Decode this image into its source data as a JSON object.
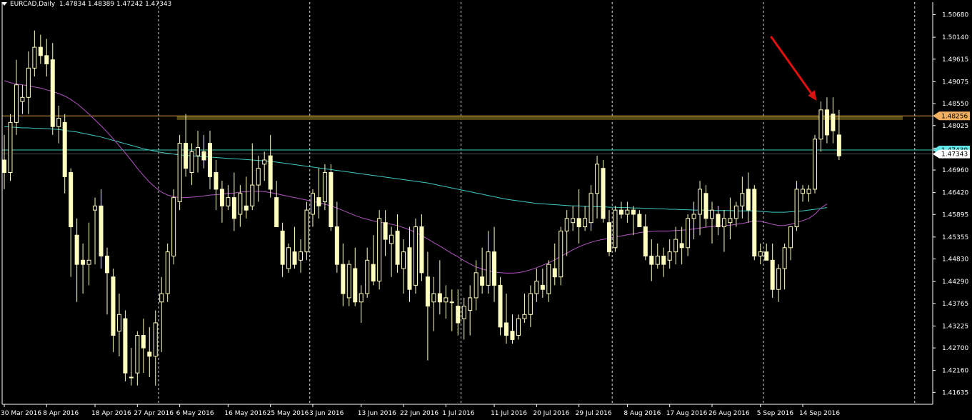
{
  "header": {
    "symbol": "EURCAD,Daily",
    "ohlc": "1.47834 1.48389 1.47242 1.47343"
  },
  "colors": {
    "background": "#000000",
    "candle": "#ffffc0",
    "axis": "#ffffff",
    "grid_vertical": "#ffffff",
    "resistance_zone": "#544a16",
    "resistance_line": "#d8a040",
    "ma_fast": "#b054c0",
    "ma_slow": "#40c8c0",
    "arrow": "#e01010",
    "price_tag_resistance": "#f0b060",
    "price_tag_slow": "#60e8e8",
    "price_tag_current": "#ffffff"
  },
  "chart_data": {
    "type": "candlestick",
    "title": "EURCAD,Daily",
    "ylim": [
      1.4135,
      1.5098
    ],
    "y_ticks": [
      "1.50680",
      "1.50140",
      "1.49615",
      "1.49075",
      "1.48550",
      "1.48025",
      "1.47485",
      "1.46960",
      "1.46420",
      "1.45895",
      "1.45355",
      "1.44830",
      "1.44290",
      "1.43765",
      "1.43225",
      "1.42700",
      "1.42160",
      "1.41635"
    ],
    "x_labels": [
      "30 Mar 2016",
      "8 Apr 2016",
      "18 Apr 2016",
      "27 Apr 2016",
      "6 May 2016",
      "16 May 2016",
      "25 May 2016",
      "3 Jun 2016",
      "13 Jun 2016",
      "22 Jun 2016",
      "1 Jul 2016",
      "11 Jul 2016",
      "20 Jul 2016",
      "29 Jul 2016",
      "8 Aug 2016",
      "17 Aug 2016",
      "26 Aug 2016",
      "5 Sep 2016",
      "14 Sep 2016"
    ],
    "x_label_bar_index": [
      0,
      7,
      15,
      22,
      29,
      37,
      44,
      51,
      59,
      66,
      73,
      81,
      88,
      95,
      103,
      110,
      117,
      125,
      132
    ],
    "grid_vertical_bar_index": [
      25,
      50,
      75,
      100,
      125,
      150
    ],
    "price_tags": {
      "resistance": "1.48256",
      "slow_ma": "1.47439",
      "current": "1.47343"
    },
    "resistance_level": 1.48256,
    "resistance_zone": [
      1.4816,
      1.48256
    ],
    "ohlc_note": "open, high, low, close",
    "candles": [
      [
        1.472,
        1.478,
        1.465,
        1.469
      ],
      [
        1.469,
        1.483,
        1.467,
        1.481
      ],
      [
        1.481,
        1.496,
        1.478,
        1.49
      ],
      [
        1.486,
        1.49,
        1.483,
        1.487
      ],
      [
        1.487,
        1.498,
        1.483,
        1.494
      ],
      [
        1.494,
        1.503,
        1.492,
        1.499
      ],
      [
        1.499,
        1.502,
        1.495,
        1.497
      ],
      [
        1.497,
        1.501,
        1.492,
        1.495
      ],
      [
        1.496,
        1.5,
        1.478,
        1.48
      ],
      [
        1.48,
        1.485,
        1.476,
        1.482
      ],
      [
        1.481,
        1.483,
        1.464,
        1.468
      ],
      [
        1.469,
        1.47,
        1.444,
        1.456
      ],
      [
        1.454,
        1.458,
        1.438,
        1.447
      ],
      [
        1.448,
        1.452,
        1.44,
        1.447
      ],
      [
        1.447,
        1.457,
        1.442,
        1.448
      ],
      [
        1.46,
        1.463,
        1.447,
        1.461
      ],
      [
        1.461,
        1.465,
        1.446,
        1.449
      ],
      [
        1.449,
        1.451,
        1.435,
        1.445
      ],
      [
        1.444,
        1.446,
        1.426,
        1.43
      ],
      [
        1.431,
        1.44,
        1.425,
        1.435
      ],
      [
        1.434,
        1.436,
        1.419,
        1.421
      ],
      [
        1.42,
        1.427,
        1.418,
        1.42
      ],
      [
        1.421,
        1.431,
        1.418,
        1.43
      ],
      [
        1.43,
        1.434,
        1.421,
        1.427
      ],
      [
        1.426,
        1.432,
        1.42,
        1.425
      ],
      [
        1.425,
        1.436,
        1.418,
        1.433
      ],
      [
        1.438,
        1.444,
        1.426,
        1.44
      ],
      [
        1.44,
        1.452,
        1.438,
        1.45
      ],
      [
        1.449,
        1.465,
        1.447,
        1.463
      ],
      [
        1.462,
        1.478,
        1.46,
        1.476
      ],
      [
        1.476,
        1.483,
        1.468,
        1.47
      ],
      [
        1.469,
        1.476,
        1.466,
        1.474
      ],
      [
        1.473,
        1.479,
        1.469,
        1.475
      ],
      [
        1.474,
        1.478,
        1.47,
        1.472
      ],
      [
        1.476,
        1.479,
        1.465,
        1.468
      ],
      [
        1.469,
        1.472,
        1.46,
        1.465
      ],
      [
        1.465,
        1.467,
        1.457,
        1.461
      ],
      [
        1.461,
        1.466,
        1.46,
        1.463
      ],
      [
        1.463,
        1.469,
        1.455,
        1.458
      ],
      [
        1.459,
        1.466,
        1.456,
        1.464
      ],
      [
        1.461,
        1.468,
        1.458,
        1.46
      ],
      [
        1.461,
        1.476,
        1.46,
        1.466
      ],
      [
        1.466,
        1.473,
        1.462,
        1.47
      ],
      [
        1.471,
        1.474,
        1.467,
        1.472
      ],
      [
        1.473,
        1.478,
        1.463,
        1.465
      ],
      [
        1.463,
        1.467,
        1.456,
        1.456
      ],
      [
        1.455,
        1.457,
        1.444,
        1.447
      ],
      [
        1.446,
        1.452,
        1.445,
        1.451
      ],
      [
        1.45,
        1.456,
        1.446,
        1.447
      ],
      [
        1.448,
        1.453,
        1.445,
        1.45
      ],
      [
        1.45,
        1.462,
        1.448,
        1.46
      ],
      [
        1.459,
        1.465,
        1.456,
        1.464
      ],
      [
        1.463,
        1.47,
        1.458,
        1.461
      ],
      [
        1.462,
        1.471,
        1.46,
        1.469
      ],
      [
        1.469,
        1.471,
        1.455,
        1.456
      ],
      [
        1.456,
        1.462,
        1.445,
        1.447
      ],
      [
        1.447,
        1.452,
        1.437,
        1.44
      ],
      [
        1.439,
        1.448,
        1.437,
        1.447
      ],
      [
        1.446,
        1.451,
        1.437,
        1.438
      ],
      [
        1.438,
        1.442,
        1.433,
        1.44
      ],
      [
        1.44,
        1.451,
        1.439,
        1.448
      ],
      [
        1.447,
        1.454,
        1.442,
        1.443
      ],
      [
        1.443,
        1.46,
        1.441,
        1.458
      ],
      [
        1.457,
        1.46,
        1.449,
        1.453
      ],
      [
        1.452,
        1.456,
        1.444,
        1.454
      ],
      [
        1.455,
        1.459,
        1.445,
        1.447
      ],
      [
        1.446,
        1.453,
        1.44,
        1.45
      ],
      [
        1.451,
        1.456,
        1.438,
        1.441
      ],
      [
        1.442,
        1.458,
        1.44,
        1.456
      ],
      [
        1.456,
        1.459,
        1.443,
        1.445
      ],
      [
        1.444,
        1.45,
        1.424,
        1.437
      ],
      [
        1.438,
        1.444,
        1.431,
        1.44
      ],
      [
        1.44,
        1.448,
        1.435,
        1.438
      ],
      [
        1.438,
        1.442,
        1.434,
        1.439
      ],
      [
        1.438,
        1.441,
        1.431,
        1.438
      ],
      [
        1.437,
        1.441,
        1.43,
        1.433
      ],
      [
        1.434,
        1.439,
        1.429,
        1.437
      ],
      [
        1.436,
        1.442,
        1.43,
        1.439
      ],
      [
        1.439,
        1.448,
        1.436,
        1.445
      ],
      [
        1.444,
        1.451,
        1.44,
        1.442
      ],
      [
        1.442,
        1.455,
        1.44,
        1.45
      ],
      [
        1.45,
        1.456,
        1.438,
        1.442
      ],
      [
        1.442,
        1.444,
        1.43,
        1.432
      ],
      [
        1.433,
        1.44,
        1.428,
        1.43
      ],
      [
        1.431,
        1.435,
        1.428,
        1.429
      ],
      [
        1.43,
        1.435,
        1.429,
        1.434
      ],
      [
        1.434,
        1.44,
        1.433,
        1.435
      ],
      [
        1.435,
        1.442,
        1.432,
        1.44
      ],
      [
        1.44,
        1.446,
        1.438,
        1.443
      ],
      [
        1.442,
        1.446,
        1.439,
        1.441
      ],
      [
        1.44,
        1.448,
        1.438,
        1.447
      ],
      [
        1.446,
        1.452,
        1.442,
        1.444
      ],
      [
        1.444,
        1.456,
        1.442,
        1.455
      ],
      [
        1.455,
        1.46,
        1.449,
        1.458
      ],
      [
        1.457,
        1.461,
        1.455,
        1.458
      ],
      [
        1.458,
        1.465,
        1.452,
        1.456
      ],
      [
        1.456,
        1.461,
        1.455,
        1.458
      ],
      [
        1.457,
        1.466,
        1.455,
        1.464
      ],
      [
        1.464,
        1.473,
        1.458,
        1.471
      ],
      [
        1.47,
        1.472,
        1.457,
        1.458
      ],
      [
        1.457,
        1.46,
        1.449,
        1.45
      ],
      [
        1.451,
        1.461,
        1.45,
        1.46
      ],
      [
        1.46,
        1.462,
        1.458,
        1.459
      ],
      [
        1.459,
        1.462,
        1.457,
        1.46
      ],
      [
        1.46,
        1.461,
        1.454,
        1.459
      ],
      [
        1.459,
        1.46,
        1.456,
        1.456
      ],
      [
        1.456,
        1.459,
        1.448,
        1.449
      ],
      [
        1.449,
        1.453,
        1.443,
        1.447
      ],
      [
        1.447,
        1.452,
        1.446,
        1.449
      ],
      [
        1.449,
        1.451,
        1.444,
        1.447
      ],
      [
        1.448,
        1.453,
        1.446,
        1.45
      ],
      [
        1.45,
        1.456,
        1.447,
        1.453
      ],
      [
        1.452,
        1.456,
        1.447,
        1.451
      ],
      [
        1.451,
        1.459,
        1.449,
        1.458
      ],
      [
        1.458,
        1.462,
        1.453,
        1.459
      ],
      [
        1.459,
        1.467,
        1.454,
        1.465
      ],
      [
        1.464,
        1.466,
        1.456,
        1.458
      ],
      [
        1.458,
        1.462,
        1.452,
        1.46
      ],
      [
        1.459,
        1.461,
        1.454,
        1.456
      ],
      [
        1.456,
        1.46,
        1.45,
        1.458
      ],
      [
        1.457,
        1.463,
        1.453,
        1.458
      ],
      [
        1.458,
        1.462,
        1.456,
        1.461
      ],
      [
        1.461,
        1.468,
        1.458,
        1.464
      ],
      [
        1.465,
        1.469,
        1.457,
        1.46
      ],
      [
        1.465,
        1.466,
        1.448,
        1.449
      ],
      [
        1.449,
        1.452,
        1.447,
        1.45
      ],
      [
        1.45,
        1.452,
        1.448,
        1.448
      ],
      [
        1.448,
        1.452,
        1.439,
        1.441
      ],
      [
        1.441,
        1.447,
        1.438,
        1.446
      ],
      [
        1.446,
        1.452,
        1.441,
        1.451
      ],
      [
        1.451,
        1.456,
        1.448,
        1.456
      ],
      [
        1.456,
        1.467,
        1.455,
        1.465
      ],
      [
        1.464,
        1.466,
        1.462,
        1.465
      ],
      [
        1.464,
        1.466,
        1.462,
        1.465
      ],
      [
        1.465,
        1.478,
        1.464,
        1.477
      ],
      [
        1.477,
        1.486,
        1.474,
        1.484
      ],
      [
        1.484,
        1.487,
        1.476,
        1.478
      ],
      [
        1.483,
        1.487,
        1.476,
        1.479
      ],
      [
        1.478,
        1.484,
        1.472,
        1.473
      ]
    ],
    "ma_fast_values": [
      1.491,
      1.4905,
      1.4902,
      1.49,
      1.4898,
      1.4895,
      1.4892,
      1.4888,
      1.4884,
      1.4879,
      1.4873,
      1.4865,
      1.4855,
      1.4843,
      1.483,
      1.4816,
      1.4802,
      1.4787,
      1.4771,
      1.4754,
      1.4737,
      1.4719,
      1.47,
      1.4683,
      1.4667,
      1.4654,
      1.4643,
      1.4636,
      1.4632,
      1.463,
      1.463,
      1.4631,
      1.4632,
      1.4634,
      1.4636,
      1.4637,
      1.4638,
      1.464,
      1.4641,
      1.4643,
      1.4644,
      1.4645,
      1.4645,
      1.4644,
      1.4642,
      1.4639,
      1.4636,
      1.4633,
      1.463,
      1.4627,
      1.4624,
      1.4621,
      1.4618,
      1.4614,
      1.461,
      1.4605,
      1.4599,
      1.4593,
      1.4587,
      1.4582,
      1.4578,
      1.4574,
      1.4571,
      1.4569,
      1.4566,
      1.4563,
      1.4558,
      1.4553,
      1.4546,
      1.4539,
      1.4531,
      1.4522,
      1.4514,
      1.4505,
      1.4496,
      1.4488,
      1.4479,
      1.4471,
      1.4464,
      1.4459,
      1.4455,
      1.4452,
      1.445,
      1.4449,
      1.4449,
      1.445,
      1.4453,
      1.4457,
      1.4462,
      1.4468,
      1.4474,
      1.4481,
      1.4489,
      1.4497,
      1.4505,
      1.4512,
      1.4518,
      1.4523,
      1.4527,
      1.453,
      1.4533,
      1.4536,
      1.4538,
      1.4541,
      1.4543,
      1.4546,
      1.4548,
      1.4549,
      1.455,
      1.455,
      1.455,
      1.4551,
      1.4552,
      1.4553,
      1.4555,
      1.4557,
      1.4559,
      1.4561,
      1.4562,
      1.4563,
      1.4564,
      1.4566,
      1.4568,
      1.4571,
      1.4574,
      1.4573,
      1.457,
      1.4566,
      1.4563,
      1.4563,
      1.4566,
      1.457,
      1.4575,
      1.458,
      1.459,
      1.4605,
      1.4615
    ],
    "ma_slow_values": [
      1.48,
      1.4799,
      1.4798,
      1.4797,
      1.4797,
      1.4796,
      1.4796,
      1.4795,
      1.4794,
      1.4793,
      1.4791,
      1.4789,
      1.4787,
      1.4784,
      1.4781,
      1.4778,
      1.4775,
      1.4771,
      1.4767,
      1.4763,
      1.4759,
      1.4755,
      1.4751,
      1.4747,
      1.4744,
      1.4741,
      1.4738,
      1.4736,
      1.4734,
      1.4732,
      1.4731,
      1.473,
      1.4729,
      1.4728,
      1.4727,
      1.4726,
      1.4725,
      1.4724,
      1.4723,
      1.4722,
      1.4721,
      1.472,
      1.4719,
      1.4718,
      1.4716,
      1.4715,
      1.4713,
      1.4711,
      1.4709,
      1.4707,
      1.4705,
      1.4703,
      1.4701,
      1.4699,
      1.4697,
      1.4695,
      1.4693,
      1.4691,
      1.4689,
      1.4687,
      1.4685,
      1.4683,
      1.4681,
      1.4679,
      1.4677,
      1.4675,
      1.4673,
      1.4671,
      1.4669,
      1.4667,
      1.4665,
      1.4662,
      1.4659,
      1.4656,
      1.4653,
      1.465,
      1.4647,
      1.4644,
      1.4641,
      1.4638,
      1.4635,
      1.4632,
      1.4629,
      1.4626,
      1.4624,
      1.4622,
      1.462,
      1.4618,
      1.4616,
      1.4615,
      1.4614,
      1.4613,
      1.4612,
      1.4611,
      1.461,
      1.461,
      1.4609,
      1.4609,
      1.4608,
      1.4608,
      1.4607,
      1.4607,
      1.4606,
      1.4606,
      1.4605,
      1.4605,
      1.4604,
      1.4604,
      1.4603,
      1.4603,
      1.4602,
      1.4602,
      1.4601,
      1.4601,
      1.46,
      1.46,
      1.46,
      1.4599,
      1.4599,
      1.4599,
      1.4599,
      1.4598,
      1.4598,
      1.4598,
      1.4598,
      1.4597,
      1.4596,
      1.4595,
      1.4595,
      1.4595,
      1.4596,
      1.4597,
      1.4598,
      1.46,
      1.4602,
      1.4604,
      1.4606
    ],
    "annotation": "red arrow pointing down to the latest highs at the resistance zone"
  }
}
